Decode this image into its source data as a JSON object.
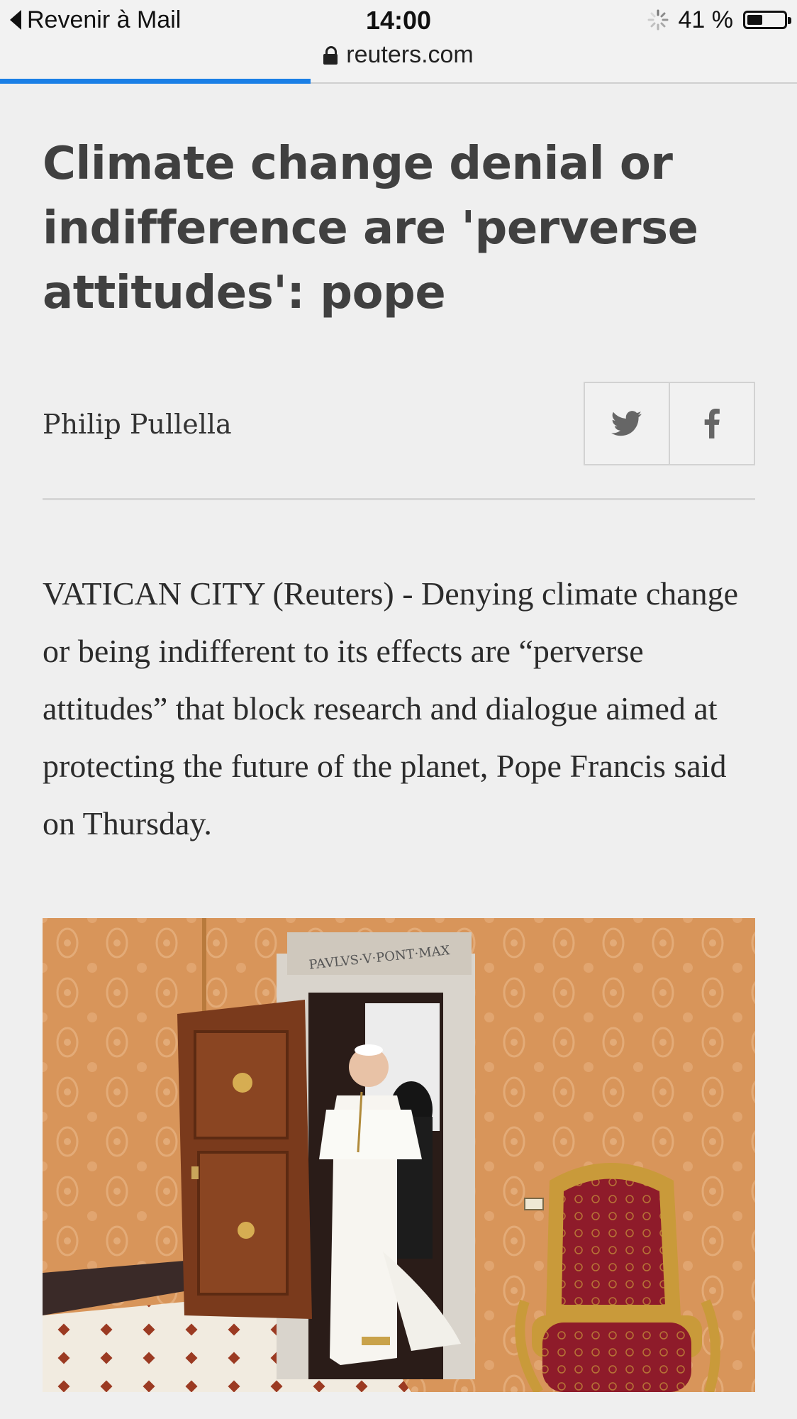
{
  "status_bar": {
    "back_label": "Revenir à Mail",
    "time": "14:00",
    "battery_text": "41 %",
    "battery_level": 0.41
  },
  "url_bar": {
    "domain": "reuters.com",
    "load_progress": 0.39
  },
  "article": {
    "headline": "Climate change denial or indifference are 'perverse attitudes': pope",
    "author": "Philip Pullella",
    "share": [
      "twitter-icon",
      "facebook-icon"
    ],
    "lead": "VATICAN CITY (Reuters) - Denying climate change or being indifferent to its effects are “perverse attitudes” that block research and dialogue aimed at protecting the future of the planet, Pope Francis said on Thursday.",
    "photo": {
      "inscription": "PAVLVS·V·PONT·MAX"
    }
  },
  "colors": {
    "progress": "#1a7fe6",
    "background": "#efefef",
    "headline": "#404040",
    "wall": "#d8955a",
    "chair_red": "#8e1b2a",
    "gold": "#c99a3a"
  }
}
